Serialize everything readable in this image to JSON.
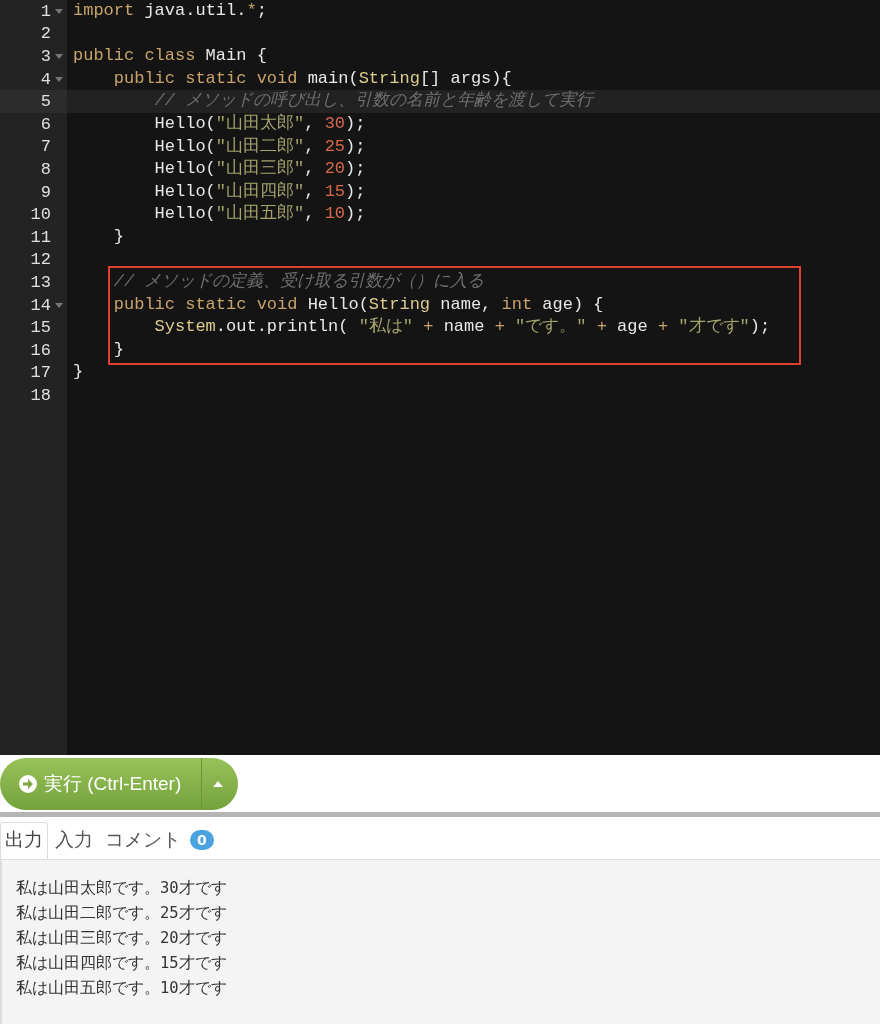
{
  "editor": {
    "lines": [
      {
        "number": "1",
        "fold": true,
        "active": false,
        "boxed": false,
        "tokens": [
          {
            "kind": "keyword",
            "text": "import"
          },
          {
            "kind": "plain",
            "text": " java.util."
          },
          {
            "kind": "operator",
            "text": "*"
          },
          {
            "kind": "plain",
            "text": ";"
          }
        ]
      },
      {
        "number": "2",
        "fold": false,
        "active": false,
        "boxed": false
      },
      {
        "number": "3",
        "fold": true,
        "active": false,
        "boxed": false,
        "tokens": [
          {
            "kind": "keyword",
            "text": "public class"
          },
          {
            "kind": "plain",
            "text": " Main {"
          }
        ]
      },
      {
        "number": "4",
        "fold": true,
        "active": false,
        "boxed": false,
        "tokens": [
          {
            "kind": "keyword",
            "text": "    public static void"
          },
          {
            "kind": "plain",
            "text": " main("
          },
          {
            "kind": "type",
            "text": "String"
          },
          {
            "kind": "plain",
            "text": "[] args){"
          }
        ]
      },
      {
        "number": "5",
        "fold": false,
        "active": true,
        "boxed": false,
        "tokens": [
          {
            "kind": "comment",
            "text": "        // メソッドの呼び出し、引数の名前と年齢を渡して実行"
          }
        ]
      },
      {
        "number": "6",
        "fold": false,
        "active": false,
        "boxed": false,
        "tokens": [
          {
            "kind": "plain",
            "text": "        Hello("
          },
          {
            "kind": "string",
            "text": "\"山田太郎\""
          },
          {
            "kind": "plain",
            "text": ", "
          },
          {
            "kind": "number",
            "text": "30"
          },
          {
            "kind": "plain",
            "text": ");"
          }
        ]
      },
      {
        "number": "7",
        "fold": false,
        "active": false,
        "boxed": false,
        "tokens": [
          {
            "kind": "plain",
            "text": "        Hello("
          },
          {
            "kind": "string",
            "text": "\"山田二郎\""
          },
          {
            "kind": "plain",
            "text": ", "
          },
          {
            "kind": "number",
            "text": "25"
          },
          {
            "kind": "plain",
            "text": ");"
          }
        ]
      },
      {
        "number": "8",
        "fold": false,
        "active": false,
        "boxed": false,
        "tokens": [
          {
            "kind": "plain",
            "text": "        Hello("
          },
          {
            "kind": "string",
            "text": "\"山田三郎\""
          },
          {
            "kind": "plain",
            "text": ", "
          },
          {
            "kind": "number",
            "text": "20"
          },
          {
            "kind": "plain",
            "text": ");"
          }
        ]
      },
      {
        "number": "9",
        "fold": false,
        "active": false,
        "boxed": false,
        "tokens": [
          {
            "kind": "plain",
            "text": "        Hello("
          },
          {
            "kind": "string",
            "text": "\"山田四郎\""
          },
          {
            "kind": "plain",
            "text": ", "
          },
          {
            "kind": "number",
            "text": "15"
          },
          {
            "kind": "plain",
            "text": ");"
          }
        ]
      },
      {
        "number": "10",
        "fold": false,
        "active": false,
        "boxed": false,
        "tokens": [
          {
            "kind": "plain",
            "text": "        Hello("
          },
          {
            "kind": "string",
            "text": "\"山田五郎\""
          },
          {
            "kind": "plain",
            "text": ", "
          },
          {
            "kind": "number",
            "text": "10"
          },
          {
            "kind": "plain",
            "text": ");"
          }
        ]
      },
      {
        "number": "11",
        "fold": false,
        "active": false,
        "boxed": false,
        "tokens": [
          {
            "kind": "plain",
            "text": "    }"
          }
        ]
      },
      {
        "number": "12",
        "fold": false,
        "active": false,
        "boxed": false
      },
      {
        "number": "13",
        "fold": false,
        "active": false,
        "boxed": true,
        "tokens": [
          {
            "kind": "comment",
            "text": "    // メソッドの定義、受け取る引数が（）に入る"
          }
        ]
      },
      {
        "number": "14",
        "fold": true,
        "active": false,
        "boxed": true,
        "tokens": [
          {
            "kind": "keyword",
            "text": "    public static void"
          },
          {
            "kind": "plain",
            "text": " Hello("
          },
          {
            "kind": "type",
            "text": "String"
          },
          {
            "kind": "plain",
            "text": " name, "
          },
          {
            "kind": "keyword",
            "text": "int"
          },
          {
            "kind": "plain",
            "text": " age) {"
          }
        ]
      },
      {
        "number": "15",
        "fold": false,
        "active": false,
        "boxed": true,
        "tokens": [
          {
            "kind": "type",
            "text": "        System"
          },
          {
            "kind": "plain",
            "text": ".out.println( "
          },
          {
            "kind": "string",
            "text": "\"私は\""
          },
          {
            "kind": "operator",
            "text": " +"
          },
          {
            "kind": "plain",
            "text": " name "
          },
          {
            "kind": "operator",
            "text": "+"
          },
          {
            "kind": "string",
            "text": " \"です。\""
          },
          {
            "kind": "operator",
            "text": " +"
          },
          {
            "kind": "plain",
            "text": " age "
          },
          {
            "kind": "operator",
            "text": "+"
          },
          {
            "kind": "string",
            "text": " \"才です\""
          },
          {
            "kind": "plain",
            "text": ");"
          }
        ]
      },
      {
        "number": "16",
        "fold": false,
        "active": false,
        "boxed": true,
        "tokens": [
          {
            "kind": "plain",
            "text": "    }"
          }
        ]
      },
      {
        "number": "17",
        "fold": false,
        "active": false,
        "boxed": false,
        "tokens": [
          {
            "kind": "plain",
            "text": "}"
          }
        ]
      },
      {
        "number": "18",
        "fold": false,
        "active": false,
        "boxed": false
      }
    ]
  },
  "run_button": {
    "label": "実行 (Ctrl-Enter)"
  },
  "tabs": [
    {
      "label": "出力",
      "selected": true
    },
    {
      "label": "入力",
      "selected": false
    },
    {
      "label": "コメント",
      "selected": false,
      "badge": "0"
    }
  ],
  "output": [
    "私は山田太郎です。30才です",
    "私は山田二郎です。25才です",
    "私は山田三郎です。20才です",
    "私は山田四郎です。15才です",
    "私は山田五郎です。10才です"
  ]
}
